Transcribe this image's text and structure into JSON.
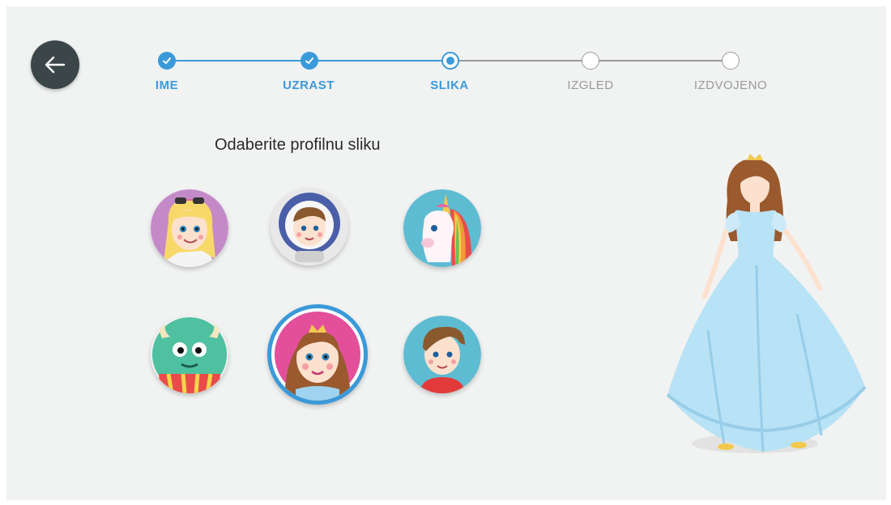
{
  "colors": {
    "accent": "#3a9ad9",
    "inactive": "#9a9a9a",
    "back_button": "#3a4647",
    "background": "#f1f2f2"
  },
  "back_icon": "arrow-left-icon",
  "steps": [
    {
      "label": "IME",
      "state": "done"
    },
    {
      "label": "UZRAST",
      "state": "done"
    },
    {
      "label": "SLIKA",
      "state": "current"
    },
    {
      "label": "IZGLED",
      "state": "todo"
    },
    {
      "label": "IZDVOJENO",
      "state": "todo"
    }
  ],
  "title": "Odaberite profilnu sliku",
  "avatars": [
    {
      "name": "girl-sunglasses",
      "selected": false
    },
    {
      "name": "astronaut-boy",
      "selected": false
    },
    {
      "name": "unicorn",
      "selected": false
    },
    {
      "name": "green-monster",
      "selected": false
    },
    {
      "name": "princess",
      "selected": true
    },
    {
      "name": "boy",
      "selected": false
    }
  ]
}
